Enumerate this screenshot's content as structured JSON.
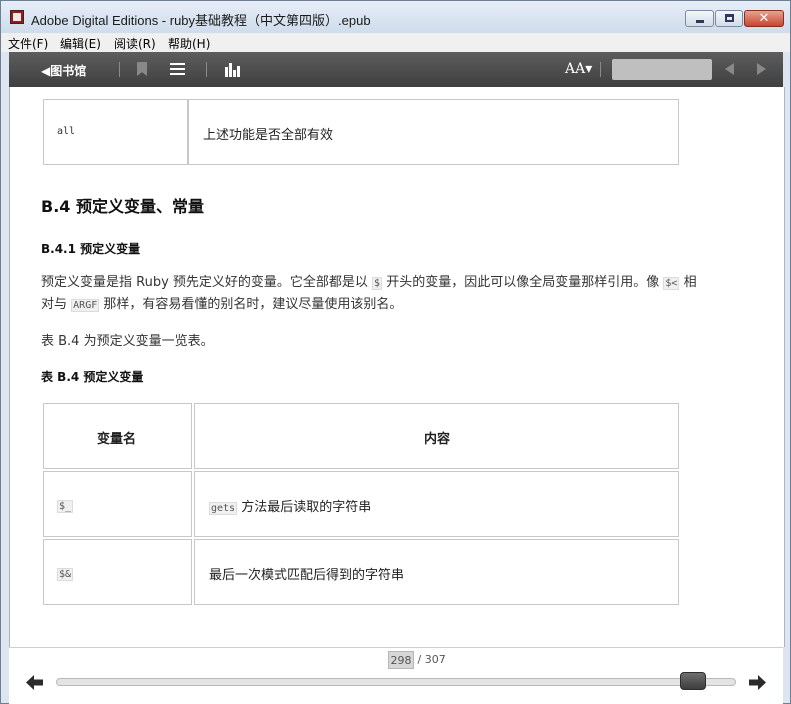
{
  "window": {
    "title": "Adobe Digital Editions - ruby基础教程（中文第四版）.epub",
    "close_glyph": "✕"
  },
  "menu": {
    "items": [
      "文件(F)",
      "编辑(E)",
      "阅读(R)",
      "帮助(H)"
    ]
  },
  "toolbar": {
    "library_label": "◀图书馆",
    "font_size_label": "AA▾",
    "search_placeholder": "",
    "icons": [
      "back-arrow-icon",
      "bookmark-icon",
      "toc-list-icon",
      "bar-chart-icon",
      "font-size-icon",
      "prev-icon",
      "next-icon"
    ]
  },
  "content": {
    "top_table": {
      "key": "all",
      "value": "上述功能是否全部有效"
    },
    "section_heading": "B.4   预定义变量、常量",
    "subsection_heading": "B.4.1   预定义变量",
    "para1_line1": {
      "a": "预定义变量是指 Ruby 预先定义好的变量。它全部都是以",
      "code1": "$",
      "b": "开头的变量，因此可以像全局变量那样引用。像",
      "code2": "$<",
      "c": "相"
    },
    "para1_line2": {
      "a": "对与",
      "code": "ARGF",
      "b": "那样，有容易看懂的别名时，建议尽量使用该别名。"
    },
    "para2": "表 B.4 为预定义变量一览表。",
    "table_caption": "表 B.4   预定义变量",
    "table": {
      "headers": [
        "变量名",
        "内容"
      ],
      "rows": [
        {
          "name": "$_",
          "content_code": "gets",
          "content_text": "方法最后读取的字符串"
        },
        {
          "name": "$&",
          "content_code": "",
          "content_text": "最后一次模式匹配后得到的字符串"
        }
      ]
    }
  },
  "pager": {
    "current_page": "298",
    "total": "/ 307",
    "progress": 0.954
  },
  "colors": {
    "toolbar_bg": "#4a4a4a",
    "close_button": "#c7452f"
  }
}
